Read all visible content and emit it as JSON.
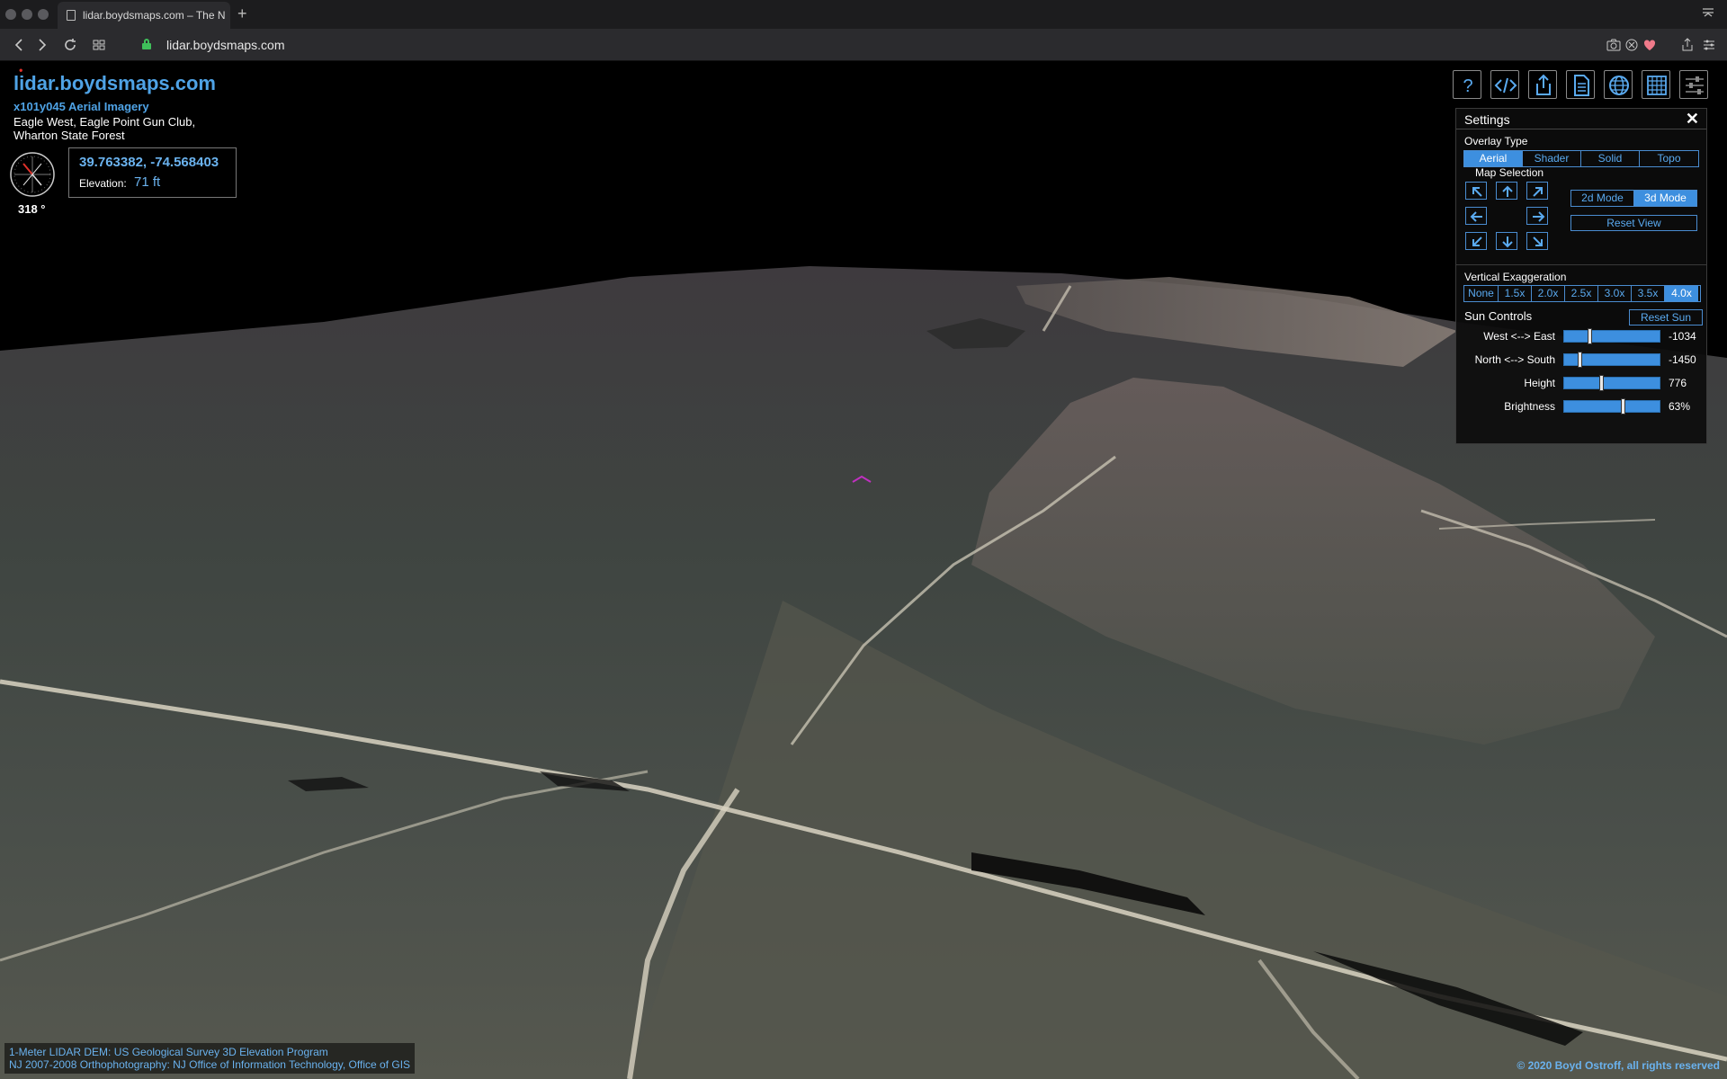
{
  "browser": {
    "tab_title": "lidar.boydsmaps.com – The N",
    "new_tab": "+",
    "url": "lidar.boydsmaps.com"
  },
  "map": {
    "site_title": "lidar.boydsmaps.com",
    "imagery_title": "x101y045 Aerial Imagery",
    "location_line1": "Eagle West, Eagle Point Gun Club,",
    "location_line2": "Wharton State Forest",
    "heading": "318 °",
    "coordinates": "39.763382, -74.568403",
    "elevation_label": "Elevation:",
    "elevation_value": "71 ft"
  },
  "toolbar": {
    "icons": [
      "help-icon",
      "code-icon",
      "share-icon",
      "document-icon",
      "globe-icon",
      "grid-icon",
      "sliders-icon"
    ],
    "help_glyph": "?"
  },
  "settings": {
    "title": "Settings",
    "close": "✕",
    "overlay_label": "Overlay Type",
    "overlay_options": [
      {
        "label": "Aerial",
        "active": true
      },
      {
        "label": "Shader",
        "active": false
      },
      {
        "label": "Solid",
        "active": false
      },
      {
        "label": "Topo",
        "active": false
      }
    ],
    "map_selection_label": "Map Selection",
    "mode_options": [
      {
        "label": "2d Mode",
        "active": false
      },
      {
        "label": "3d Mode",
        "active": true
      }
    ],
    "reset_view": "Reset View",
    "exaggeration_label": "Vertical Exaggeration",
    "exaggeration_options": [
      {
        "label": "None",
        "active": false
      },
      {
        "label": "1.5x",
        "active": false
      },
      {
        "label": "2.0x",
        "active": false
      },
      {
        "label": "2.5x",
        "active": false
      },
      {
        "label": "3.0x",
        "active": false
      },
      {
        "label": "3.5x",
        "active": false
      },
      {
        "label": "4.0x",
        "active": true
      }
    ],
    "sun_label": "Sun Controls",
    "reset_sun": "Reset Sun",
    "sliders": [
      {
        "label": "West <--> East",
        "value": "-1034",
        "fraction": 0.26
      },
      {
        "label": "North <--> South",
        "value": "-1450",
        "fraction": 0.15
      },
      {
        "label": "Height",
        "value": "776",
        "fraction": 0.39
      },
      {
        "label": "Brightness",
        "value": "63%",
        "fraction": 0.63
      }
    ]
  },
  "attribution": {
    "line1": "1-Meter LIDAR DEM: US Geological Survey 3D Elevation Program",
    "line2": "NJ 2007-2008 Orthophotography: NJ Office of Information Technology, Office of GIS",
    "copyright": "© 2020 Boyd Ostroff, all rights reserved"
  },
  "colors": {
    "accent": "#3d8fdf",
    "link": "#4fa3e6",
    "secure": "#3fbf5a"
  }
}
